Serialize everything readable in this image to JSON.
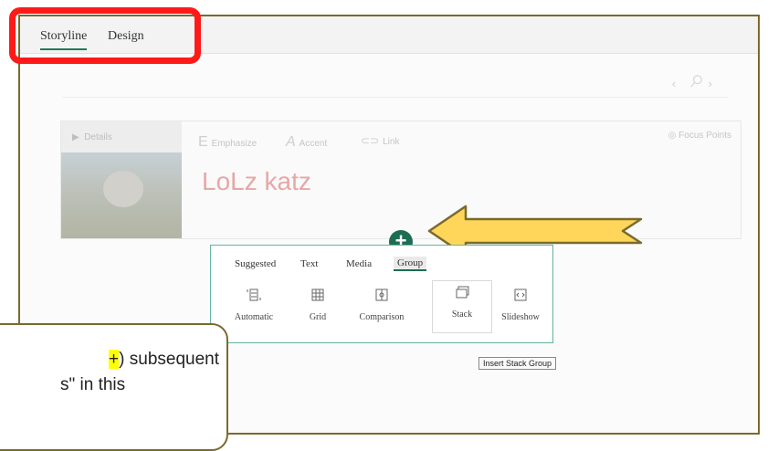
{
  "tabs": [
    "Storyline",
    "Design"
  ],
  "card": {
    "details_label": "Details",
    "toolbar": [
      "Emphasize",
      "Accent",
      "Link"
    ],
    "focus_label": "Focus Points",
    "title": "LoLz katz"
  },
  "add_button": "+",
  "insert_panel": {
    "tabs": [
      "Suggested",
      "Text",
      "Media",
      "Group"
    ],
    "options": [
      "Automatic",
      "Grid",
      "Comparison",
      "Stack",
      "Slideshow"
    ]
  },
  "tooltip": "Insert Stack Group",
  "callout": {
    "line1_hl": "+",
    "line1_rest": ") subsequent",
    "line2": "s\" in this"
  },
  "colors": {
    "accent_green": "#1c6d54",
    "highlight_red": "#ff1a1a",
    "arrow_fill": "#ffd65a",
    "arrow_stroke": "#7a6a2c"
  }
}
